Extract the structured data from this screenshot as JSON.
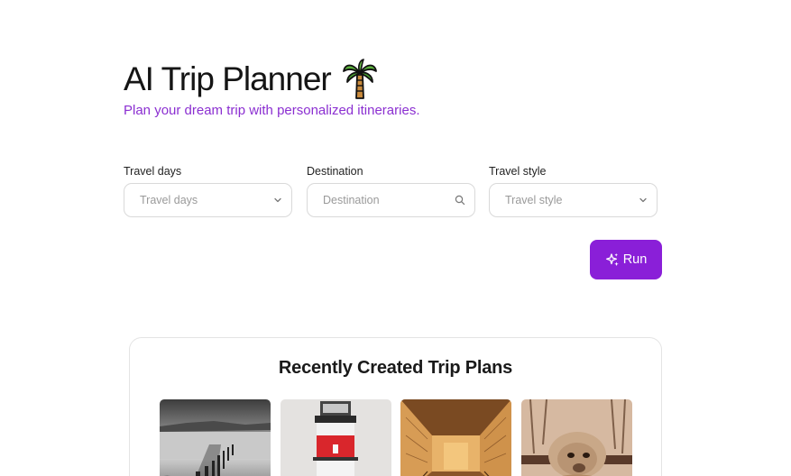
{
  "header": {
    "title": "AI Trip Planner",
    "title_icon": "palm-tree-icon",
    "subtitle": "Plan your dream trip with personalized itineraries."
  },
  "form": {
    "travel_days": {
      "label": "Travel days",
      "placeholder": "Travel days",
      "icon": "chevron-down-icon"
    },
    "destination": {
      "label": "Destination",
      "placeholder": "Destination",
      "icon": "search-icon"
    },
    "travel_style": {
      "label": "Travel style",
      "placeholder": "Travel style",
      "icon": "chevron-down-icon"
    },
    "run_label": "Run",
    "run_icon": "sparkle-icon"
  },
  "recent": {
    "title": "Recently Created Trip Plans",
    "plans": [
      {
        "image": "pier-posts-bw-photo"
      },
      {
        "image": "red-white-lighthouse-photo"
      },
      {
        "image": "ancient-tomb-corridor-photo"
      },
      {
        "image": "alpaca-photo"
      }
    ]
  },
  "colors": {
    "accent": "#8a1fd8",
    "subtitle": "#8b2fd1",
    "border": "#d9d9d9",
    "placeholder": "#9a9a9a"
  }
}
